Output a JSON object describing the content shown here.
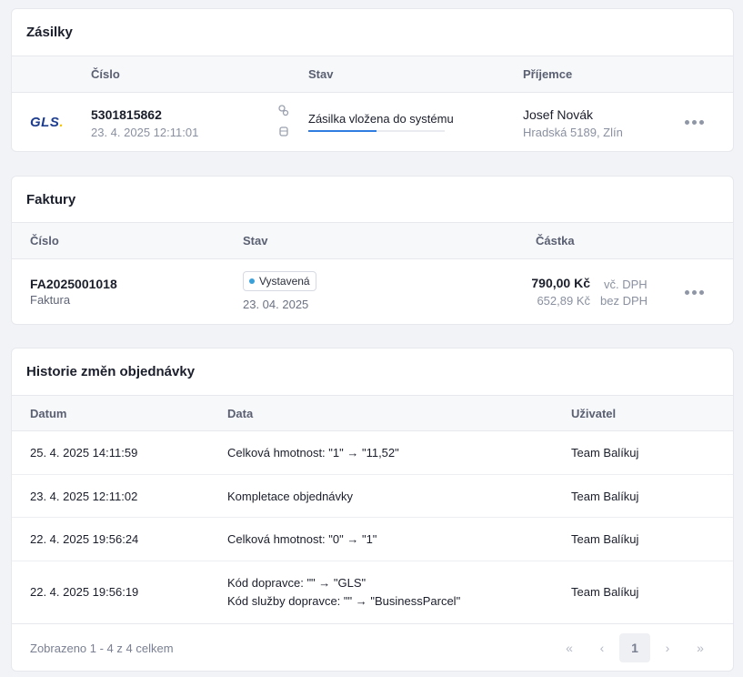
{
  "shipments": {
    "title": "Zásilky",
    "columns": {
      "number": "Číslo",
      "status": "Stav",
      "recipient": "Příjemce"
    },
    "rows": [
      {
        "carrier_logo": "GLS",
        "number": "5301815862",
        "date": "23. 4. 2025 12:11:01",
        "status_icons": [
          "package-icon",
          "scale-icon"
        ],
        "status": "Zásilka vložena do systému",
        "progress": 0.5,
        "recipient_name": "Josef Novák",
        "recipient_address": "Hradská 5189, Zlín"
      }
    ]
  },
  "invoices": {
    "title": "Faktury",
    "columns": {
      "number": "Číslo",
      "status": "Stav",
      "amount": "Částka"
    },
    "rows": [
      {
        "number": "FA2025001018",
        "type": "Faktura",
        "status": "Vystavená",
        "status_color": "#3aa0d8",
        "date": "23. 04. 2025",
        "amount_with_vat": "790,00 Kč",
        "with_vat_label": "vč. DPH",
        "amount_without_vat": "652,89 Kč",
        "without_vat_label": "bez DPH"
      }
    ]
  },
  "history": {
    "title": "Historie změn objednávky",
    "columns": {
      "date": "Datum",
      "data": "Data",
      "user": "Uživatel"
    },
    "rows": [
      {
        "date": "25. 4. 2025 14:11:59",
        "lines": [
          "Celková hmotnost: \"1\" → \"11,52\""
        ],
        "user": "Team Balíkuj"
      },
      {
        "date": "23. 4. 2025 12:11:02",
        "lines": [
          "Kompletace objednávky"
        ],
        "user": "Team Balíkuj"
      },
      {
        "date": "22. 4. 2025 19:56:24",
        "lines": [
          "Celková hmotnost: \"0\" → \"1\""
        ],
        "user": "Team Balíkuj"
      },
      {
        "date": "22. 4. 2025 19:56:19",
        "lines": [
          "Kód dopravce: \"\" → \"GLS\"",
          "Kód služby dopravce: \"\" → \"BusinessParcel\""
        ],
        "user": "Team Balíkuj"
      }
    ],
    "footer": "Zobrazeno 1 - 4 z 4 celkem",
    "pagination": {
      "first": "«",
      "prev": "‹",
      "current": "1",
      "next": "›",
      "last": "»"
    }
  },
  "colors": {
    "accent": "#2f7de1",
    "background": "#f2f3f7"
  }
}
